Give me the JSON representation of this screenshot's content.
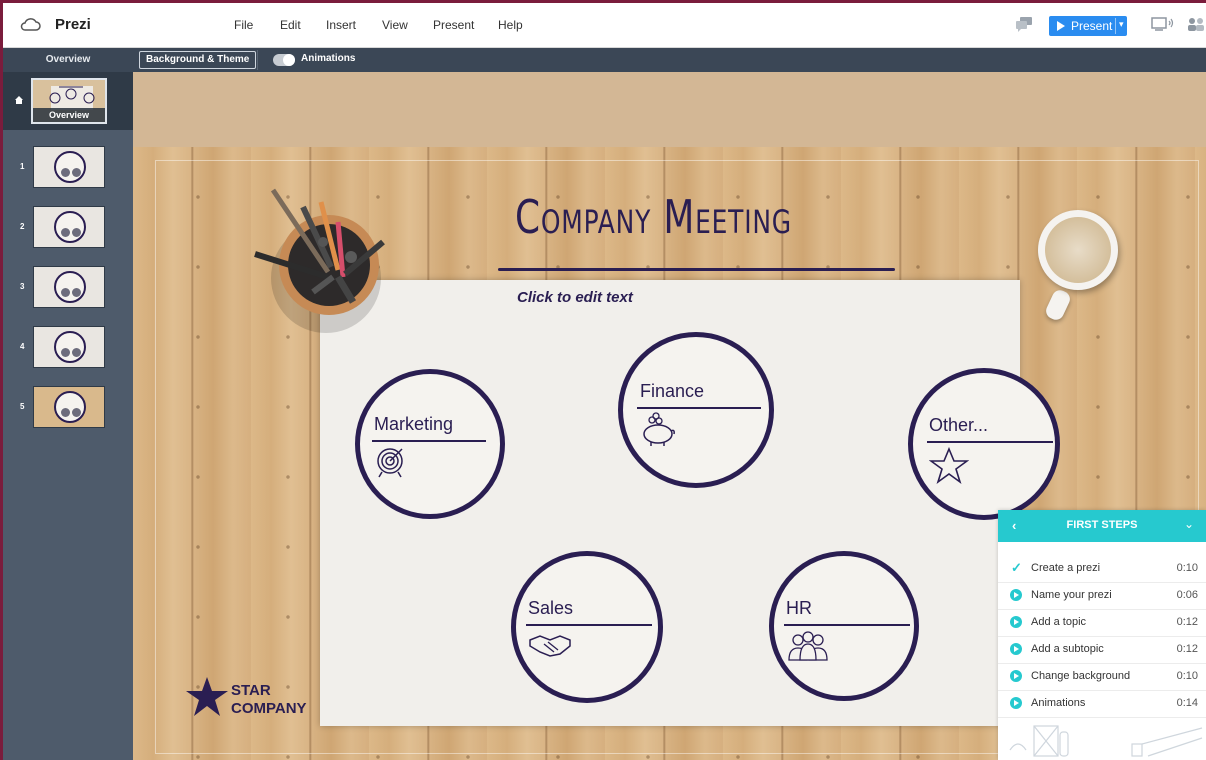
{
  "app": {
    "title": "Prezi"
  },
  "menu": [
    "File",
    "Edit",
    "Insert",
    "View",
    "Present",
    "Help"
  ],
  "present_button": {
    "label": "Present"
  },
  "toolbar": {
    "overview_tab": "Overview",
    "background_theme": "Background & Theme",
    "animations": "Animations",
    "animations_on": true
  },
  "sidebar": {
    "overview_label": "Overview",
    "slides": [
      "1",
      "2",
      "3",
      "4",
      "5"
    ]
  },
  "canvas": {
    "title": "Company Meeting",
    "click_text": "Click to edit text",
    "topics": {
      "marketing": "Marketing",
      "finance": "Finance",
      "other": "Other...",
      "sales": "Sales",
      "hr": "HR"
    },
    "logo_line1": "STAR",
    "logo_line2": "COMPANY"
  },
  "first_steps": {
    "title": "FIRST STEPS",
    "items": [
      {
        "name": "Create a prezi",
        "time": "0:10",
        "done": true
      },
      {
        "name": "Name your prezi",
        "time": "0:06",
        "done": false
      },
      {
        "name": "Add a topic",
        "time": "0:12",
        "done": false
      },
      {
        "name": "Add a subtopic",
        "time": "0:12",
        "done": false
      },
      {
        "name": "Change background",
        "time": "0:10",
        "done": false
      },
      {
        "name": "Animations",
        "time": "0:14",
        "done": false
      }
    ]
  },
  "colors": {
    "accent": "#2a8cf0",
    "teal": "#26c9cf",
    "ink": "#2a1e52"
  }
}
